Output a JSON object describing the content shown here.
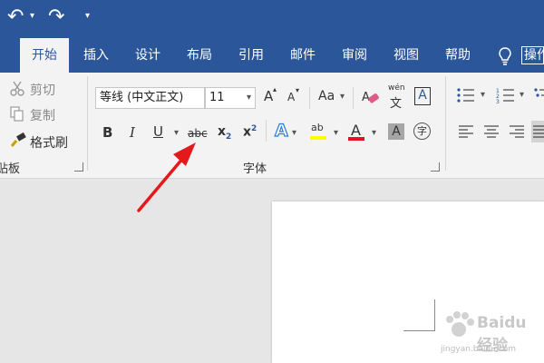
{
  "qat": {
    "undo_glyph": "↶",
    "redo_glyph": "↷",
    "dropdown_glyph": "▾",
    "customize_glyph": "▾"
  },
  "tabs": [
    "开始",
    "插入",
    "设计",
    "布局",
    "引用",
    "邮件",
    "审阅",
    "视图",
    "帮助"
  ],
  "tell_me": {
    "label": "操作"
  },
  "clipboard": {
    "cut": "剪切",
    "copy": "复制",
    "format_painter": "格式刷",
    "group_label": "贴板"
  },
  "font": {
    "font_name": "等线 (中文正文)",
    "font_size": "11",
    "grow": "A",
    "shrink": "A",
    "change_case": "Aa",
    "phonetic_top": "wén",
    "phonetic_bottom": "文",
    "char_border": "A",
    "bold": "B",
    "italic": "I",
    "underline": "U",
    "strike": "abc",
    "subscript_base": "x",
    "subscript_sub": "2",
    "superscript_base": "x",
    "superscript_sup": "2",
    "text_effects": "A",
    "highlight_label": "ab",
    "font_color": "A",
    "char_shading": "A",
    "enclose": "字",
    "group_label": "字体"
  },
  "colors": {
    "title_bar": "#2b579a",
    "highlight_bar": "#ffff00",
    "font_color_bar": "#e81123",
    "arrow": "#e3191b"
  },
  "watermark": {
    "brand": "Baidu 经验",
    "url": "jingyan.baidu.com"
  }
}
